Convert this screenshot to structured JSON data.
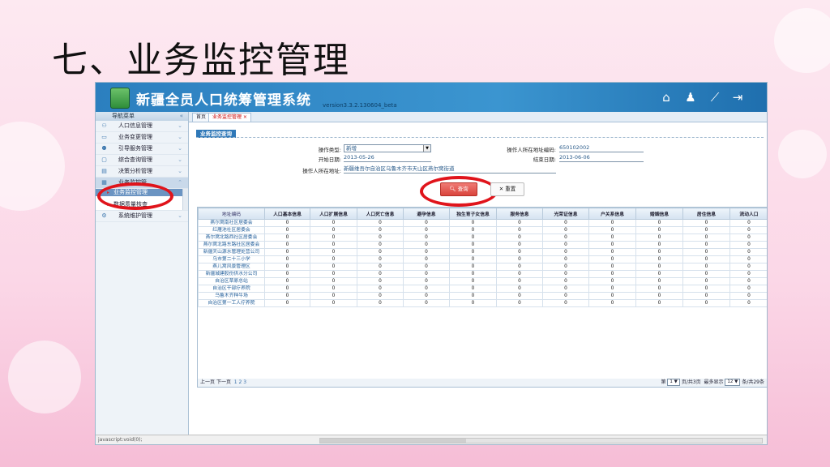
{
  "slide": {
    "title": "七、业务监控管理"
  },
  "app": {
    "title": "新疆全员人口统筹管理系统",
    "version": "version3.3.2.130604_beta",
    "header_icons": [
      "home-icon",
      "bell-icon",
      "tools-icon",
      "logout-icon"
    ]
  },
  "sidebar": {
    "header": "导航菜单",
    "items": [
      {
        "label": "人口信息管理"
      },
      {
        "label": "业务变更管理"
      },
      {
        "label": "引导服务管理"
      },
      {
        "label": "综合查询管理"
      },
      {
        "label": "决策分析管理"
      },
      {
        "label": "业务监控管"
      },
      {
        "label": "系统维护管理"
      }
    ],
    "sub_items": [
      {
        "label": "业务监控管理"
      },
      {
        "label": "数据质量核查"
      }
    ]
  },
  "tabs": [
    {
      "label": "首页"
    },
    {
      "label": "业务监控管理 ×"
    }
  ],
  "panel": {
    "title": "业务监控查询"
  },
  "form": {
    "op_type_label": "操作类型:",
    "op_type_value": "新增",
    "addr_code_label": "操作人所在地址编码:",
    "addr_code_value": "650102002",
    "start_label": "开始日期:",
    "start_value": "2013-05-26",
    "end_label": "结束日期:",
    "end_value": "2013-06-06",
    "addr_label": "操作人所在地址:",
    "addr_value": "新疆维吾尔自治区乌鲁木齐市天山区燕尔窝街道",
    "query_button": "查询",
    "reset_button": "重置"
  },
  "table": {
    "columns": [
      "地址编码",
      "人口基本信息",
      "人口扩展信息",
      "人口死亡信息",
      "避孕信息",
      "独生育子女信息",
      "服务信息",
      "光荣证信息",
      "户关系信息",
      "婚姻信息",
      "居住信息",
      "流动人口"
    ],
    "rows": [
      [
        "燕尔窝南社区居委会",
        "0",
        "0",
        "0",
        "0",
        "0",
        "0",
        "0",
        "0",
        "0",
        "0",
        "0"
      ],
      [
        "红雁池社区居委会",
        "0",
        "0",
        "0",
        "0",
        "0",
        "0",
        "0",
        "0",
        "0",
        "0",
        "0"
      ],
      [
        "燕尔窝北路西社区居委会",
        "0",
        "0",
        "0",
        "0",
        "0",
        "0",
        "0",
        "0",
        "0",
        "0",
        "0"
      ],
      [
        "燕尔窝北路东路社区居委会",
        "0",
        "0",
        "0",
        "0",
        "0",
        "0",
        "0",
        "0",
        "0",
        "0",
        "0"
      ],
      [
        "新疆天山源水管理处营公司",
        "0",
        "0",
        "0",
        "0",
        "0",
        "0",
        "0",
        "0",
        "0",
        "0",
        "0"
      ],
      [
        "乌市第二十三小学",
        "0",
        "0",
        "0",
        "0",
        "0",
        "0",
        "0",
        "0",
        "0",
        "0",
        "0"
      ],
      [
        "燕儿窝风景管理区",
        "0",
        "0",
        "0",
        "0",
        "0",
        "0",
        "0",
        "0",
        "0",
        "0",
        "0"
      ],
      [
        "新疆城建股份供水分公司",
        "0",
        "0",
        "0",
        "0",
        "0",
        "0",
        "0",
        "0",
        "0",
        "0",
        "0"
      ],
      [
        "自治区草原总站",
        "0",
        "0",
        "0",
        "0",
        "0",
        "0",
        "0",
        "0",
        "0",
        "0",
        "0"
      ],
      [
        "自治区干部疗养院",
        "0",
        "0",
        "0",
        "0",
        "0",
        "0",
        "0",
        "0",
        "0",
        "0",
        "0"
      ],
      [
        "乌鲁木齐种牛场",
        "0",
        "0",
        "0",
        "0",
        "0",
        "0",
        "0",
        "0",
        "0",
        "0",
        "0"
      ],
      [
        "自治区第一工人疗养院",
        "0",
        "0",
        "0",
        "0",
        "0",
        "0",
        "0",
        "0",
        "0",
        "0",
        "0"
      ]
    ]
  },
  "pager": {
    "prev": "上一页",
    "next": "下一页",
    "pages": "1 2 3",
    "page_label": "第",
    "page_value": "1",
    "total_pages": "页/共3页",
    "max_label": "最多显示",
    "max_value": "12",
    "total_rows": "条/共29条"
  },
  "status": {
    "text": "javascript:void(0);"
  }
}
